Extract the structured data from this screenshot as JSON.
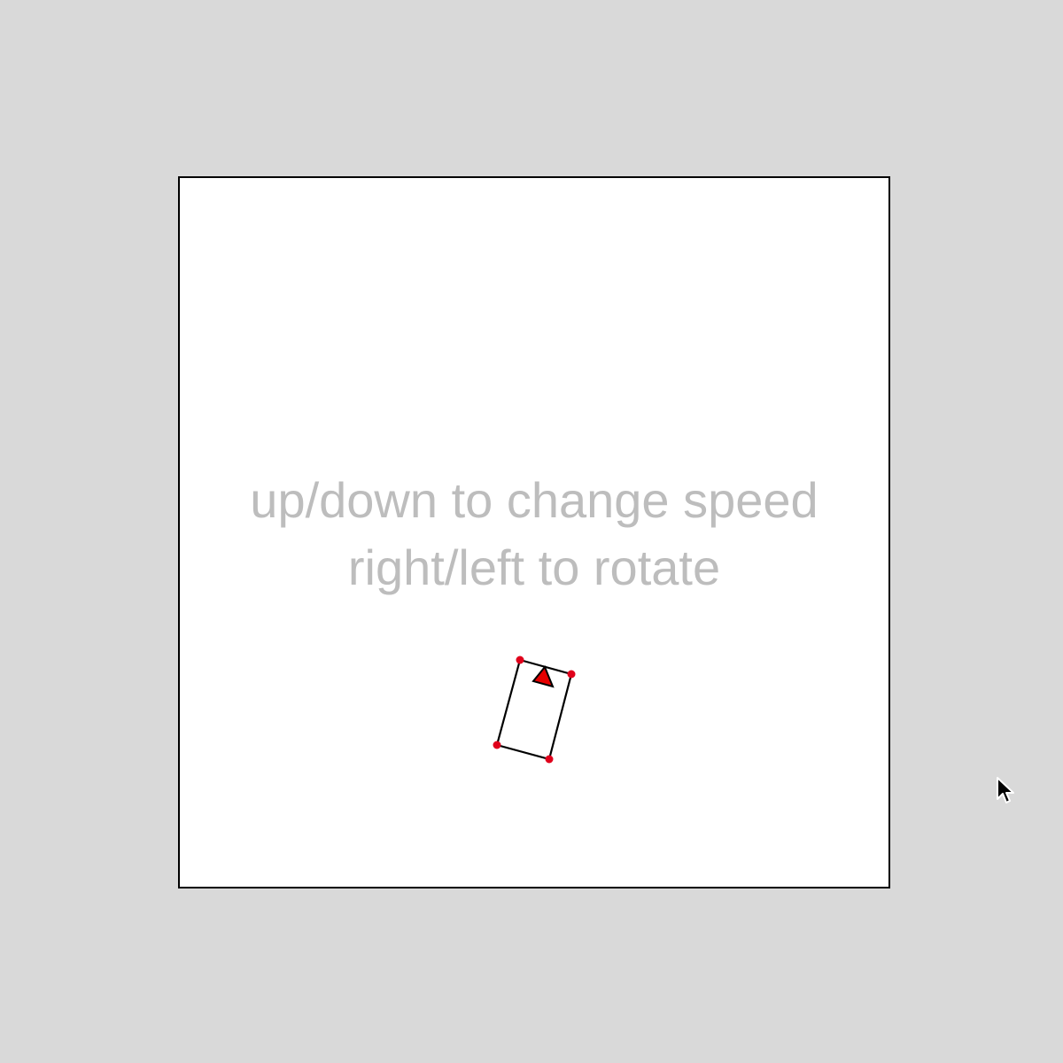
{
  "game": {
    "instructions": {
      "line1": "up/down to change speed",
      "line2": "right/left to rotate"
    },
    "player": {
      "name": "car",
      "corner_marker_color": "#e0001b",
      "heading_marker_color": "#e60000",
      "outline_color": "#000000"
    },
    "colors": {
      "background": "#d9d9d9",
      "playfield": "#ffffff",
      "border": "#000000",
      "instruction_text": "#bdbdbd"
    },
    "cursor_icon": "arrow-pointer-icon"
  }
}
